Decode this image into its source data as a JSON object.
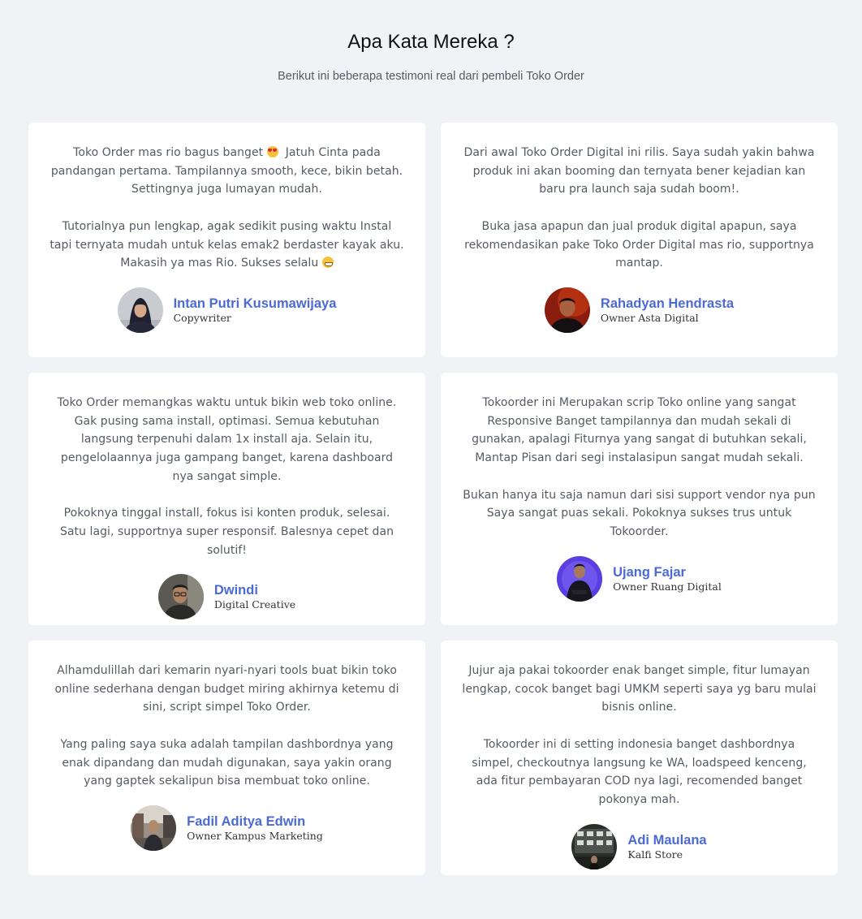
{
  "section": {
    "title": "Apa Kata Mereka ?",
    "subtitle": "Berikut ini beberapa testimoni real dari pembeli Toko Order"
  },
  "testimonials": [
    {
      "paragraphs": [
        "Toko Order mas rio bagus banget 😍  Jatuh Cinta pada pandangan pertama. Tampilannya smooth, kece, bikin betah. Settingnya juga lumayan mudah.",
        "Tutorialnya pun lengkap, agak sedikit pusing waktu Instal tapi ternyata mudah untuk kelas emak2 berdaster kayak aku. Makasih ya mas Rio. Sukses selalu 😁"
      ],
      "name": "Intan Putri Kusumawijaya",
      "role": "Copywriter",
      "avatar_icon": "avatar-woman-hijab"
    },
    {
      "paragraphs": [
        "Dari awal Toko Order Digital ini rilis. Saya sudah yakin bahwa produk ini akan booming dan ternyata bener kejadian kan baru pra launch saja sudah boom!.",
        "Buka jasa apapun dan jual produk digital apapun, saya rekomendasikan pake Toko Order Digital mas rio, supportnya mantap."
      ],
      "name": "Rahadyan Hendrasta",
      "role": "Owner Asta Digital",
      "avatar_icon": "avatar-man-red"
    },
    {
      "paragraphs": [
        "Toko Order memangkas waktu untuk bikin web toko online. Gak pusing sama install, optimasi. Semua kebutuhan langsung terpenuhi dalam 1x install aja. Selain itu, pengelolaannya juga gampang banget, karena dashboard nya sangat simple.",
        "Pokoknya tinggal install, fokus isi konten produk, selesai. Satu lagi, supportnya super responsif. Balesnya cepet dan solutif!"
      ],
      "name": "Dwindi",
      "role": "Digital Creative",
      "avatar_icon": "avatar-man-glasses"
    },
    {
      "paragraphs": [
        "Tokoorder ini Merupakan scrip Toko online yang sangat Responsive Banget tampilannya dan mudah sekali di gunakan, apalagi Fiturnya yang sangat di butuhkan sekali, Mantap Pisan dari segi instalasipun sangat mudah sekali.",
        "Bukan hanya itu saja namun dari sisi support vendor nya pun Saya sangat puas sekali. Pokoknya sukses trus untuk Tokoorder."
      ],
      "name": "Ujang Fajar",
      "role": "Owner Ruang Digital",
      "avatar_icon": "avatar-man-purple"
    },
    {
      "paragraphs": [
        "Alhamdulillah dari kemarin nyari-nyari tools buat bikin toko online sederhana dengan budget miring akhirnya ketemu di sini, script simpel Toko Order.",
        "Yang paling saya suka adalah tampilan dashbordnya yang enak dipandang dan mudah digunakan, saya yakin orang yang gaptek sekalipun bisa membuat toko online."
      ],
      "name": "Fadil Aditya Edwin",
      "role": "Owner Kampus Marketing",
      "avatar_icon": "avatar-man-street"
    },
    {
      "paragraphs": [
        "Jujur aja pakai tokoorder enak banget simple, fitur lumayan lengkap, cocok banget bagi UMKM seperti saya yg baru mulai bisnis online.",
        "Tokoorder ini di setting indonesia banget dashbordnya simpel, checkoutnya langsung ke WA, loadspeed kenceng, ada fitur pembayaran COD nya lagi, recomended banget pokonya mah."
      ],
      "name": "Adi Maulana",
      "role": "Kalfi Store",
      "avatar_icon": "avatar-man-building"
    }
  ],
  "colors": {
    "background": "#f0f2f5",
    "card": "#ffffff",
    "name_accent": "#4c6ad4",
    "body_text": "#555b63"
  }
}
